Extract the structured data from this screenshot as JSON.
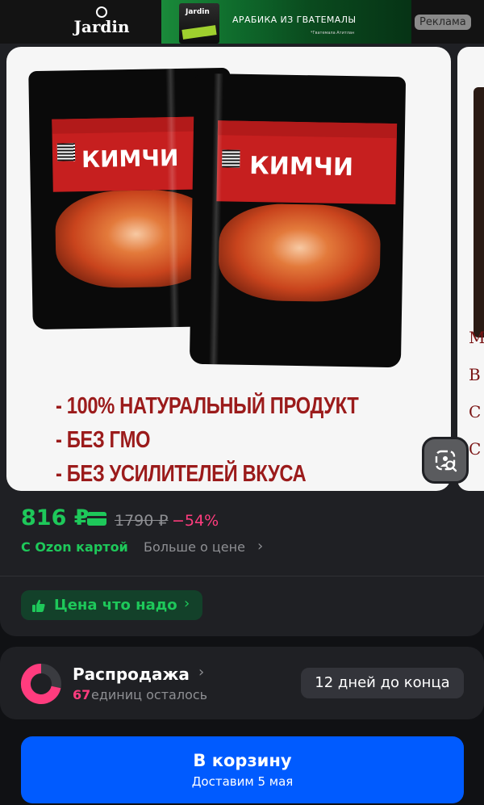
{
  "ad": {
    "brand": "Jardin",
    "pack_label": "Jardin",
    "headline": "АРАБИКА ИЗ ГВАТЕМАЛЫ",
    "subtext": "*Гватемала Атитлан",
    "badge": "Реклама"
  },
  "product": {
    "image_brand": "КИМЧИ",
    "features": [
      "- 100% НАТУРАЛЬНЫЙ ПРОДУКТ",
      "- БЕЗ ГМО",
      "- БЕЗ УСИЛИТЕЛЕЙ ВКУСА"
    ],
    "next_image_letters": [
      "М",
      "В",
      "С",
      "С"
    ]
  },
  "price": {
    "current": "816 ₽",
    "old": "1790 ₽",
    "discount": "−54%",
    "card_label": "С Ozon картой",
    "more_label": "Больше о цене",
    "chevron": "›"
  },
  "good_price": {
    "label": "Цена что надо",
    "chevron": "›"
  },
  "sale": {
    "title": "Распродажа",
    "chevron": "›",
    "count": "67",
    "count_text": "единиц осталось",
    "timer": "12 дней до конца"
  },
  "cart": {
    "title": "В корзину",
    "subtitle": "Доставим 5 мая"
  },
  "colors": {
    "background": "#101114",
    "card": "#1f2024",
    "green": "#1ec85a",
    "pink": "#ff3c7e",
    "blue": "#005bff"
  },
  "icons": [
    "image-search-icon",
    "ozon-card-icon",
    "thumbs-up-icon",
    "chevron-right-icon",
    "sale-ring-icon"
  ]
}
